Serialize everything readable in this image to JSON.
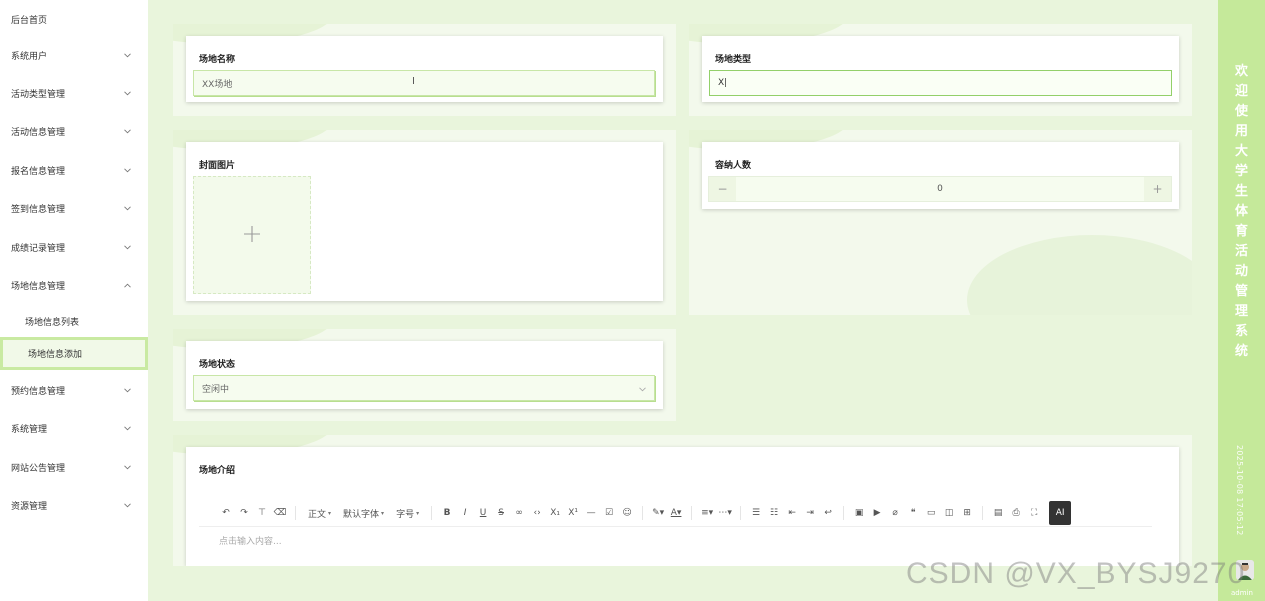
{
  "sidebar": {
    "items": [
      {
        "label": "后台首页",
        "chevron": "none"
      },
      {
        "label": "系统用户",
        "chevron": "down"
      },
      {
        "label": "活动类型管理",
        "chevron": "down"
      },
      {
        "label": "活动信息管理",
        "chevron": "down"
      },
      {
        "label": "报名信息管理",
        "chevron": "down"
      },
      {
        "label": "签到信息管理",
        "chevron": "down"
      },
      {
        "label": "成绩记录管理",
        "chevron": "down"
      },
      {
        "label": "场地信息管理",
        "chevron": "up"
      },
      {
        "label": "预约信息管理",
        "chevron": "down"
      },
      {
        "label": "系统管理",
        "chevron": "down"
      },
      {
        "label": "网站公告管理",
        "chevron": "down"
      },
      {
        "label": "资源管理",
        "chevron": "down"
      }
    ],
    "sub_items": [
      {
        "label": "场地信息列表",
        "active": false
      },
      {
        "label": "场地信息添加",
        "active": true
      }
    ]
  },
  "form": {
    "name": {
      "label": "场地名称",
      "value": "XX场地"
    },
    "type": {
      "label": "场地类型",
      "value": "X|"
    },
    "cover": {
      "label": "封面图片"
    },
    "capacity": {
      "label": "容纳人数",
      "value": "0",
      "minus": "−",
      "plus": "+"
    },
    "status": {
      "label": "场地状态",
      "value": "空闲中"
    },
    "intro": {
      "label": "场地介绍",
      "placeholder": "点击输入内容..."
    }
  },
  "editor_toolbar": {
    "paragraph": "正文",
    "font_family": "默认字体",
    "font_size": "字号",
    "ai": "AI"
  },
  "banner": {
    "welcome_chars": [
      "欢",
      "迎",
      "使",
      "用",
      "大",
      "学",
      "生",
      "体",
      "育",
      "活",
      "动",
      "管",
      "理",
      "系",
      "统"
    ],
    "datetime": "2025-10-08 17:05:12",
    "user": "admin"
  },
  "watermark": "CSDN @VX_BYSJ9270",
  "colors": {
    "accent": "#c5e99a",
    "page_bg": "#e9f5dc",
    "input_bg": "#f6fcef",
    "input_border": "#c8e6a7"
  }
}
